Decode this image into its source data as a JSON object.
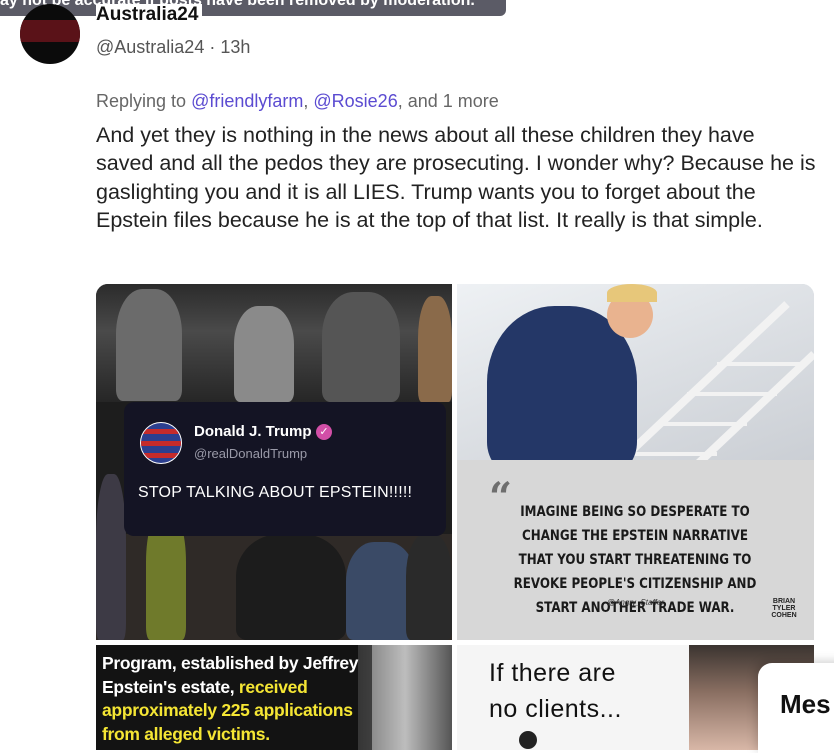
{
  "moderation_notice": "ay not be accurate if posts have been removed by moderation.",
  "post": {
    "display_name": "Australia24",
    "handle": "@Australia24",
    "time": "13h",
    "reply_prefix": "Replying to ",
    "reply_user_1": "@friendlyfarm",
    "reply_user_2": "@Rosie26",
    "reply_suffix": ", and 1 more",
    "body": "And yet they is nothing in the news about all these children they have saved and all the pedos they are prosecuting. I wonder why? Because he is gaslighting you and it is all LIES. Trump wants you to forget about the Epstein files because he is at the top of that list. It really is that simple."
  },
  "media": {
    "tweet_card": {
      "name": "Donald J. Trump",
      "handle": "@realDonaldTrump",
      "text": "STOP TALKING ABOUT EPSTEIN!!!!!"
    },
    "quote_card": {
      "text": "IMAGINE BEING SO DESPERATE TO CHANGE THE EPSTEIN NARRATIVE THAT YOU START THREATENING TO REVOKE PEOPLE'S CITIZENSHIP AND START ANOTHER TRADE WAR.",
      "attribution": "@Angry_Staffer",
      "brand": "BRIAN TYLER COHEN"
    },
    "caption": {
      "line1": "Program, established by Jeffrey",
      "line2a": "Epstein's estate, ",
      "line2b": "received",
      "line3": "approximately 225 applications",
      "line4": "from alleged victims."
    },
    "meme": {
      "line1": "If there are",
      "line2": "no clients..."
    }
  },
  "message_button": {
    "label": "Mes"
  }
}
